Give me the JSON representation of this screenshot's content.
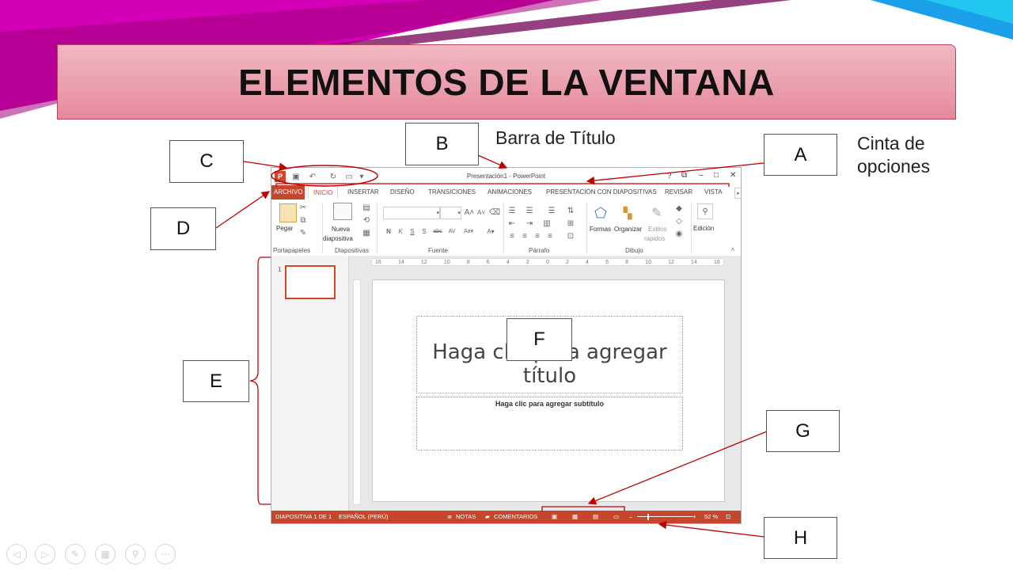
{
  "slide": {
    "title": "ELEMENTOS DE LA VENTANA",
    "labels": {
      "a": "A",
      "b": "B",
      "c": "C",
      "d": "D",
      "e": "E",
      "f": "F",
      "g": "G",
      "h": "H"
    },
    "notes": {
      "b": "Barra de Título",
      "a_line1": "Cinta de",
      "a_line2": "opciones"
    },
    "accent": "#c00000"
  },
  "ppt": {
    "window_title": "Presentación1 - PowerPoint",
    "window_controls": [
      "?",
      "⧉",
      "–",
      "□",
      "✕"
    ],
    "tabs": [
      "ARCHIVO",
      "INICIO",
      "INSERTAR",
      "DISEÑO",
      "TRANSICIONES",
      "ANIMACIONES",
      "PRESENTACIÓN CON DIAPOSITIVAS",
      "REVISAR",
      "VISTA"
    ],
    "ribbon": {
      "pegar": "Pegar",
      "nueva1": "Nueva",
      "nueva2": "diapositiva",
      "formas": "Formas",
      "organizar": "Organizar",
      "estilos1": "Estilos",
      "estilos2": "rápidos",
      "edicion": "Edición",
      "groups": [
        "Portapapeles",
        "Diapositivas",
        "Fuente",
        "Párrafo",
        "Dibujo"
      ]
    },
    "ruler_marks": [
      "16",
      "14",
      "12",
      "10",
      "8",
      "6",
      "4",
      "2",
      "0",
      "2",
      "4",
      "6",
      "8",
      "10",
      "12",
      "14",
      "16"
    ],
    "thumb_number": "1",
    "placeholder_title": "Haga clic para agregar título",
    "placeholder_subtitle": "Haga clic para agregar subtítulo",
    "status": {
      "slide": "DIAPOSITIVA 1 DE 1",
      "lang": "ESPAÑOL (PERÚ)",
      "notes": "NOTAS",
      "comments": "COMENTARIOS",
      "zoom": "52 %"
    },
    "ribbon_color": "#c5462c"
  }
}
